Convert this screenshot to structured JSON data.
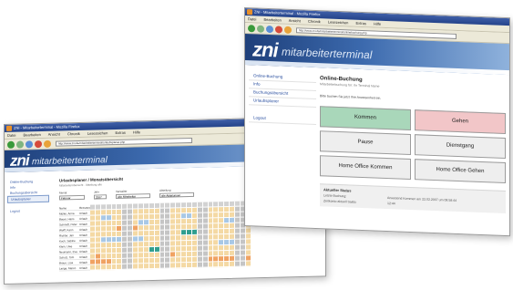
{
  "back_window": {
    "title": "ZNI - Mitarbeiterterminal - Mozilla Firefox",
    "menu": [
      "Datei",
      "Bearbeiten",
      "Ansicht",
      "Chronik",
      "Lesezeichen",
      "Extras",
      "Hilfe"
    ],
    "url": "http://www.zni.de/mitarbeiterterminal/urlaubsplaner.php",
    "logo": "zni",
    "logo_word": "mitarbeiterterminal",
    "nav": [
      "Online-Buchung",
      "Info",
      "Buchungsübersicht",
      "Urlaubsplaner",
      "Logout"
    ],
    "heading": "Urlaubsplaner / Monatsübersicht",
    "subheading": "Mitarbeiterübersicht · Abteilung alle",
    "filters": [
      {
        "label": "Monat",
        "value": "Februar"
      },
      {
        "label": "Jahr",
        "value": "2007"
      },
      {
        "label": "Verwalter",
        "value": "Alle Mitarbeiter"
      },
      {
        "label": "Abteilung",
        "value": "alle Abteilungen"
      }
    ],
    "calendar": {
      "name_header": "Name",
      "type_header": "Ressource",
      "rows": [
        {
          "name": "Müller, Anna",
          "pattern": "wwwwwwggwwwwwggwwwwwggwwwwwggw"
        },
        {
          "name": "Bauer, Hans",
          "pattern": "wwbbwwggwwwwwggwwbbwggwwwwwggw"
        },
        {
          "name": "Schmidt, Peter",
          "pattern": "wwwwwwggwbbwwggwwwwwggwwwbbggw"
        },
        {
          "name": "Wolff, Karin",
          "pattern": "wwwwwoggowwwwggwwwwwggwwwwwggw"
        },
        {
          "name": "Richter, Jan",
          "pattern": "wwwwwwggwwwwwggwwtttggwwwwwggw"
        },
        {
          "name": "Koch, Sabine",
          "pattern": "wwbbbbggbbwwwggwwwwwggwwwwwggw"
        },
        {
          "name": "Klein, Uwe",
          "pattern": "wwwwwwggwwwwwggwwwwwggwwbbbggw"
        },
        {
          "name": "Neumann, Eva",
          "pattern": "wwwwwwggwwwttggwwwwwggwwwwwggw"
        },
        {
          "name": "Schulz, Tom",
          "pattern": "wowwwwggwwwwwggowwwwggwwwwwggw"
        },
        {
          "name": "Braun, Lisa",
          "pattern": "oooowwggwwwwwggwwwwwggoooooggo"
        },
        {
          "name": "Lange, Marco",
          "pattern": "wwwwwwggwwwwwggwwwwwggwwwwwggw"
        }
      ],
      "row_type": "Urlaub"
    },
    "cell_colors": {
      "w": "#f4d9a4",
      "g": "#c5c5c5",
      "b": "#a8c8e6",
      "t": "#2f9e8f",
      "o": "#f0a262"
    }
  },
  "front_window": {
    "title": "ZNI - Mitarbeiterterminal - Mozilla Firefox",
    "menu": [
      "Datei",
      "Bearbeiten",
      "Ansicht",
      "Chronik",
      "Lesezeichen",
      "Extras",
      "Hilfe"
    ],
    "url": "http://www.zni.de/mitarbeiterterminal/onlinebuchung.php",
    "logo": "zni",
    "logo_word": "mitarbeiterterminal",
    "nav": [
      "Online-Buchung",
      "Info",
      "Buchungsübersicht",
      "Urlaubsplaner",
      "Logout"
    ],
    "heading": "Online-Buchung",
    "subheading": "Mitarbeiterbuchung für: Ihr Terminal Name",
    "hint": "Bitte buchen Sie jetzt Ihre Anwesenheit ein.",
    "buttons": {
      "kommen": "Kommen",
      "gehen": "Gehen",
      "pause": "Pause",
      "dienstgang": "Dienstgang",
      "home_office_kommen": "Home Office Kommen",
      "home_office_gehen": "Home Office Gehen"
    },
    "status": {
      "title": "Aktueller Status",
      "rows": [
        {
          "label": "Letzte Buchung:",
          "value": "Anwesend Kommen am 22.02.2007 um 08:58:44"
        },
        {
          "label": "Zeitkonto aktuell Saldo:",
          "value": "12:44"
        }
      ]
    }
  },
  "colors": {
    "brand_dark": "#1e3f7a",
    "brand_light": "#8fb2dc",
    "link": "#2b50a0",
    "kommen": "#a9d7ba",
    "gehen": "#f2c6c8"
  }
}
